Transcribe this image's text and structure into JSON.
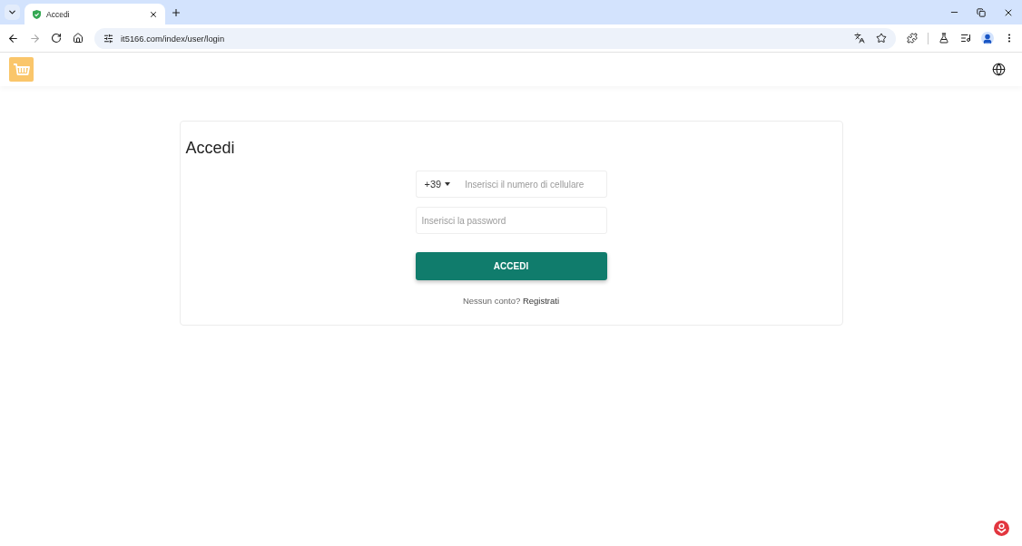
{
  "browser": {
    "tabs": [
      {
        "title": "Accedi",
        "selected": true
      }
    ],
    "address": "it5166.com/index/user/login"
  },
  "login": {
    "title": "Accedi",
    "country_code": "+39",
    "phone_placeholder": "Inserisci il numero di cellulare",
    "password_placeholder": "Inserisci la password",
    "submit": "ACCEDI",
    "signup_prompt": "Nessun conto?",
    "signup_link": "Registrati"
  }
}
